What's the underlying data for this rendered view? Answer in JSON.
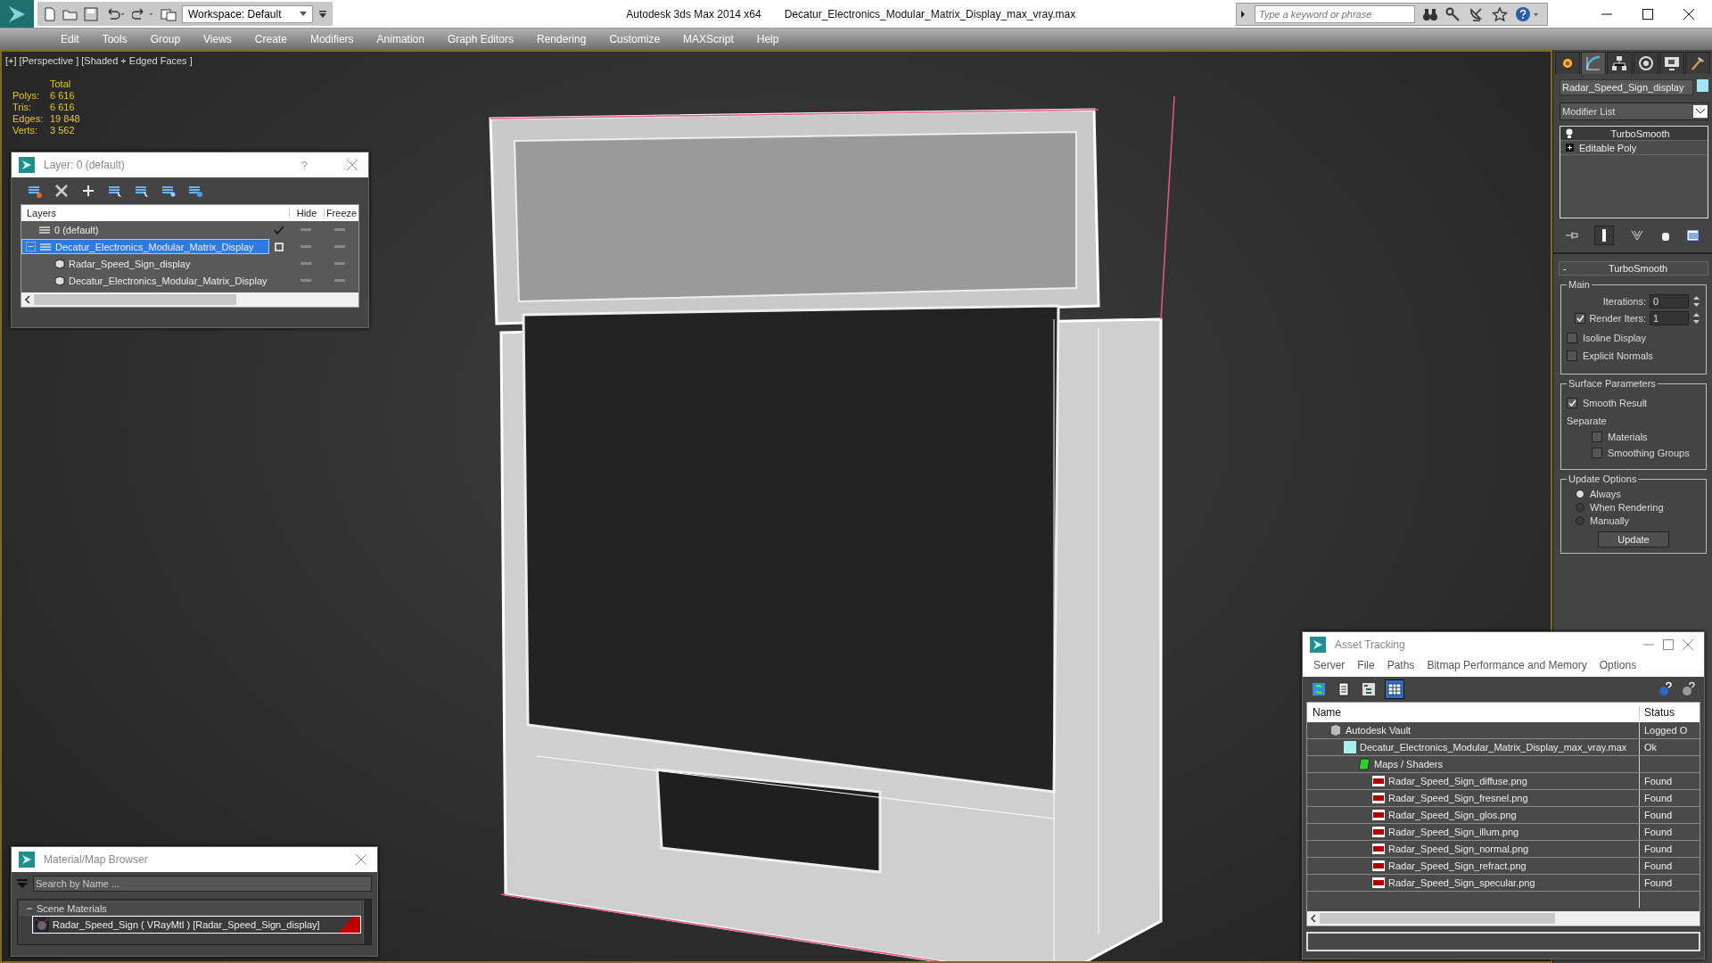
{
  "title_bar": {
    "workspace": "Workspace: Default",
    "app_title": "Autodesk 3ds Max  2014 x64",
    "file_name": "Decatur_Electronics_Modular_Matrix_Display_max_vray.max",
    "search": {
      "placeholder": "Type a keyword or phrase"
    }
  },
  "menu_bar": [
    "Edit",
    "Tools",
    "Group",
    "Views",
    "Create",
    "Modifiers",
    "Animation",
    "Graph Editors",
    "Rendering",
    "Customize",
    "MAXScript",
    "Help"
  ],
  "viewport": {
    "label": "[+] [Perspective ] [Shaded + Edged Faces ]",
    "stats": {
      "header": "Total",
      "rows": [
        {
          "label": "Polys:",
          "value": "6 616"
        },
        {
          "label": "Tris:",
          "value": "6 616"
        },
        {
          "label": "Edges:",
          "value": "19 848"
        },
        {
          "label": "Verts:",
          "value": "3 562"
        }
      ]
    }
  },
  "layer_dialog": {
    "title": "Layer: 0 (default)",
    "help": "?",
    "columns": [
      "Layers",
      "Hide",
      "Freeze"
    ],
    "rows": [
      {
        "name": "0 (default)",
        "kind": "layer",
        "selected": false,
        "current": true
      },
      {
        "name": "Decatur_Electronics_Modular_Matrix_Display",
        "kind": "layer",
        "selected": true,
        "current": false,
        "expanded": true,
        "children": [
          {
            "name": "Radar_Speed_Sign_display",
            "kind": "object",
            "selected": false
          },
          {
            "name": "Decatur_Electronics_Modular_Matrix_Display",
            "kind": "object",
            "selected": false
          }
        ]
      }
    ]
  },
  "command_panel": {
    "tabs": [
      {
        "kind": "create",
        "selected": false
      },
      {
        "kind": "modify",
        "selected": true
      },
      {
        "kind": "hierarchy",
        "selected": false
      },
      {
        "kind": "motion",
        "selected": false
      },
      {
        "kind": "display",
        "selected": false
      },
      {
        "kind": "utilities",
        "selected": false
      }
    ],
    "object_name": "Radar_Speed_Sign_display",
    "modifier_list": "Modifier List",
    "stack": [
      {
        "name": "TurboSmooth",
        "kind": "modifier",
        "selected": true
      },
      {
        "name": "Editable Poly",
        "kind": "base",
        "selected": false
      }
    ],
    "rollout": {
      "title": "TurboSmooth",
      "toggle": "-",
      "main": {
        "title": "Main",
        "iterations": {
          "label": "Iterations:",
          "value": "0"
        },
        "render_iters": {
          "label": "Render Iters:",
          "value": "1",
          "checked": true
        },
        "checks": [
          {
            "label": "Isoline Display",
            "checked": false
          },
          {
            "label": "Explicit Normals",
            "checked": false
          }
        ]
      },
      "surface": {
        "title": "Surface Parameters",
        "smooth_result": {
          "label": "Smooth Result",
          "checked": true
        },
        "separate": "Separate",
        "checks": [
          {
            "label": "Materials",
            "checked": false
          },
          {
            "label": "Smoothing Groups",
            "checked": false
          }
        ]
      },
      "update": {
        "title": "Update Options",
        "options": [
          {
            "label": "Always",
            "selected": true
          },
          {
            "label": "When Rendering",
            "selected": false
          },
          {
            "label": "Manually",
            "selected": false
          }
        ],
        "button": "Update"
      }
    }
  },
  "asset_tracking": {
    "title": "Asset Tracking",
    "menu": [
      "Server",
      "File",
      "Paths",
      "Bitmap Performance and Memory",
      "Options"
    ],
    "toolbar": [
      {
        "kind": "refresh",
        "selected": false
      },
      {
        "kind": "list",
        "selected": false
      },
      {
        "kind": "tree",
        "selected": false
      },
      {
        "kind": "table",
        "selected": true
      }
    ],
    "columns": [
      "Name",
      "Status"
    ],
    "rows": [
      {
        "name": "Autodesk Vault",
        "kind": "vault",
        "status": "Logged O",
        "children": [
          {
            "name": "Decatur_Electronics_Modular_Matrix_Display_max_vray.max",
            "kind": "max",
            "status": "Ok",
            "children": [
              {
                "name": "Maps / Shaders",
                "kind": "folder",
                "children": [
                  {
                    "name": "Radar_Speed_Sign_diffuse.png",
                    "kind": "png",
                    "status": "Found"
                  },
                  {
                    "name": "Radar_Speed_Sign_fresnel.png",
                    "kind": "png",
                    "status": "Found"
                  },
                  {
                    "name": "Radar_Speed_Sign_glos.png",
                    "kind": "png",
                    "status": "Found"
                  },
                  {
                    "name": "Radar_Speed_Sign_illum.png",
                    "kind": "png",
                    "status": "Found"
                  },
                  {
                    "name": "Radar_Speed_Sign_normal.png",
                    "kind": "png",
                    "status": "Found"
                  },
                  {
                    "name": "Radar_Speed_Sign_refract.png",
                    "kind": "png",
                    "status": "Found"
                  },
                  {
                    "name": "Radar_Speed_Sign_specular.png",
                    "kind": "png",
                    "status": "Found"
                  }
                ]
              }
            ]
          }
        ]
      }
    ]
  },
  "material_browser": {
    "title": "Material/Map Browser",
    "search": {
      "placeholder": "Search by Name ..."
    },
    "groups": [
      {
        "name": "Scene Materials",
        "expanded": true,
        "items": [
          {
            "name": "Radar_Speed_Sign ( VRayMtl ) [Radar_Speed_Sign_display]",
            "selected": true
          }
        ]
      }
    ]
  }
}
